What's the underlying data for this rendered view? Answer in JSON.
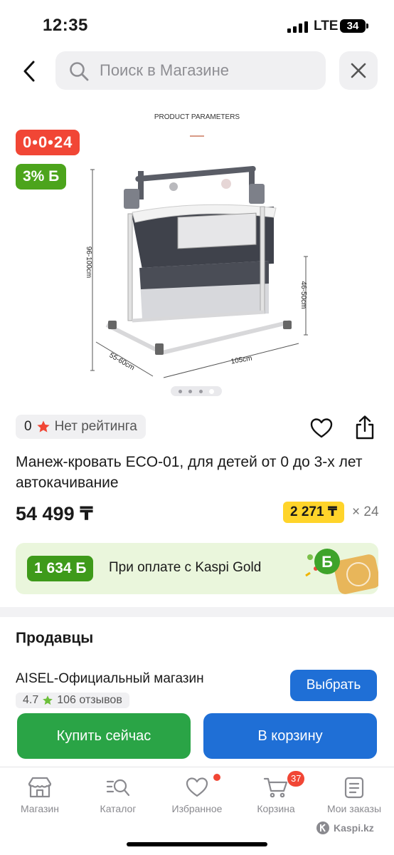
{
  "status_bar": {
    "time": "12:35",
    "network": "LTE",
    "battery": "34"
  },
  "search": {
    "placeholder": "Поиск в Магазине"
  },
  "gallery": {
    "header": "PRODUCT PARAMETERS",
    "dims": {
      "height": "96-100cm",
      "side": "46-50cm",
      "width": "105cm",
      "depth": "55-60cm"
    },
    "slides": 4,
    "current_slide": 4,
    "badge_installment": "0•0•24",
    "badge_bonus": "3% Б"
  },
  "rating": {
    "value": "0",
    "label": "Нет рейтинга"
  },
  "product": {
    "title": "Манеж-кровать ECO-01, для детей от 0 до 3-х лет автокачивание",
    "price": "54 499 ₸",
    "monthly": "2 271 ₸",
    "months": "× 24"
  },
  "kaspi_gold": {
    "bonus": "1 634 Б",
    "text": "При оплате с Kaspi Gold"
  },
  "sellers": {
    "title": "Продавцы",
    "items": [
      {
        "name": "AISEL-Официальный магазин",
        "rating": "4.7",
        "reviews": "106 отзывов",
        "button": "Выбрать"
      }
    ]
  },
  "actions": {
    "buy_now": "Купить сейчас",
    "to_cart": "В корзину"
  },
  "tabs": [
    {
      "label": "Магазин",
      "icon": "shop-icon"
    },
    {
      "label": "Каталог",
      "icon": "catalog-icon"
    },
    {
      "label": "Избранное",
      "icon": "heart-icon"
    },
    {
      "label": "Корзина",
      "icon": "cart-icon",
      "badge": "37"
    },
    {
      "label": "Мои заказы",
      "icon": "orders-icon"
    }
  ],
  "watermark": "Kaspi.kz",
  "colors": {
    "red": "#f14635",
    "green": "#4ca41c",
    "blue": "#1f6fd6",
    "buy_green": "#2aa446",
    "yellow": "#ffd42a"
  }
}
